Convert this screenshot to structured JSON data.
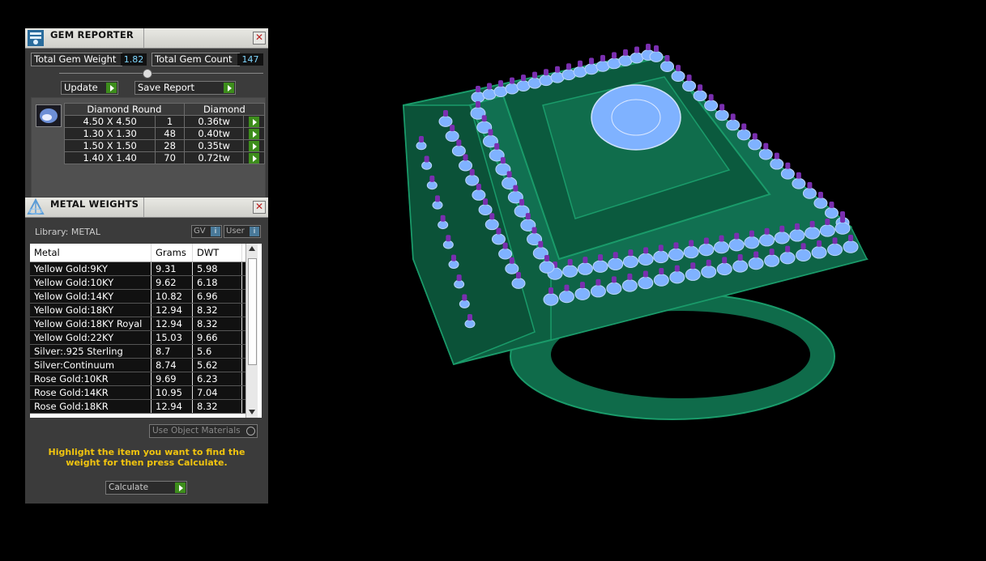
{
  "gem_reporter": {
    "title": "GEM REPORTER",
    "total_weight_label": "Total Gem Weight",
    "total_weight_value": "1.82",
    "total_count_label": "Total Gem Count",
    "total_count_value": "147",
    "update_label": "Update",
    "save_report_label": "Save Report",
    "table_header": {
      "shape": "Diamond Round",
      "material": "Diamond"
    },
    "rows": [
      {
        "size": "4.50 X 4.50",
        "count": "1",
        "weight": "0.36tw"
      },
      {
        "size": "1.30 X 1.30",
        "count": "48",
        "weight": "0.40tw"
      },
      {
        "size": "1.50 X 1.50",
        "count": "28",
        "weight": "0.35tw"
      },
      {
        "size": "1.40 X 1.40",
        "count": "70",
        "weight": "0.72tw"
      }
    ]
  },
  "metal_weights": {
    "title": "METAL WEIGHTS",
    "library_label": "Library: METAL",
    "gv_label": "GV",
    "user_label": "User",
    "columns": {
      "metal": "Metal",
      "grams": "Grams",
      "dwt": "DWT"
    },
    "rows": [
      {
        "metal": "Yellow Gold:9KY",
        "grams": "9.31",
        "dwt": "5.98"
      },
      {
        "metal": "Yellow Gold:10KY",
        "grams": "9.62",
        "dwt": "6.18"
      },
      {
        "metal": "Yellow Gold:14KY",
        "grams": "10.82",
        "dwt": "6.96"
      },
      {
        "metal": "Yellow Gold:18KY",
        "grams": "12.94",
        "dwt": "8.32"
      },
      {
        "metal": "Yellow Gold:18KY Royal",
        "grams": "12.94",
        "dwt": "8.32"
      },
      {
        "metal": "Yellow Gold:22KY",
        "grams": "15.03",
        "dwt": "9.66"
      },
      {
        "metal": "Silver:.925 Sterling",
        "grams": "8.7",
        "dwt": "5.6"
      },
      {
        "metal": "Silver:Continuum",
        "grams": "8.74",
        "dwt": "5.62"
      },
      {
        "metal": "Rose Gold:10KR",
        "grams": "9.69",
        "dwt": "6.23"
      },
      {
        "metal": "Rose Gold:14KR",
        "grams": "10.95",
        "dwt": "7.04"
      },
      {
        "metal": "Rose Gold:18KR",
        "grams": "12.94",
        "dwt": "8.32"
      }
    ],
    "use_object_materials_label": "Use Object Materials",
    "hint_text": "Highlight the item you want to find the weight for then press Calculate.",
    "calculate_label": "Calculate"
  },
  "colors": {
    "ring_metal": "#0f6b4a",
    "gem_blue": "#7fb2ff",
    "prong_purple": "#7a2fb0",
    "hint_yellow": "#f1c40f"
  }
}
